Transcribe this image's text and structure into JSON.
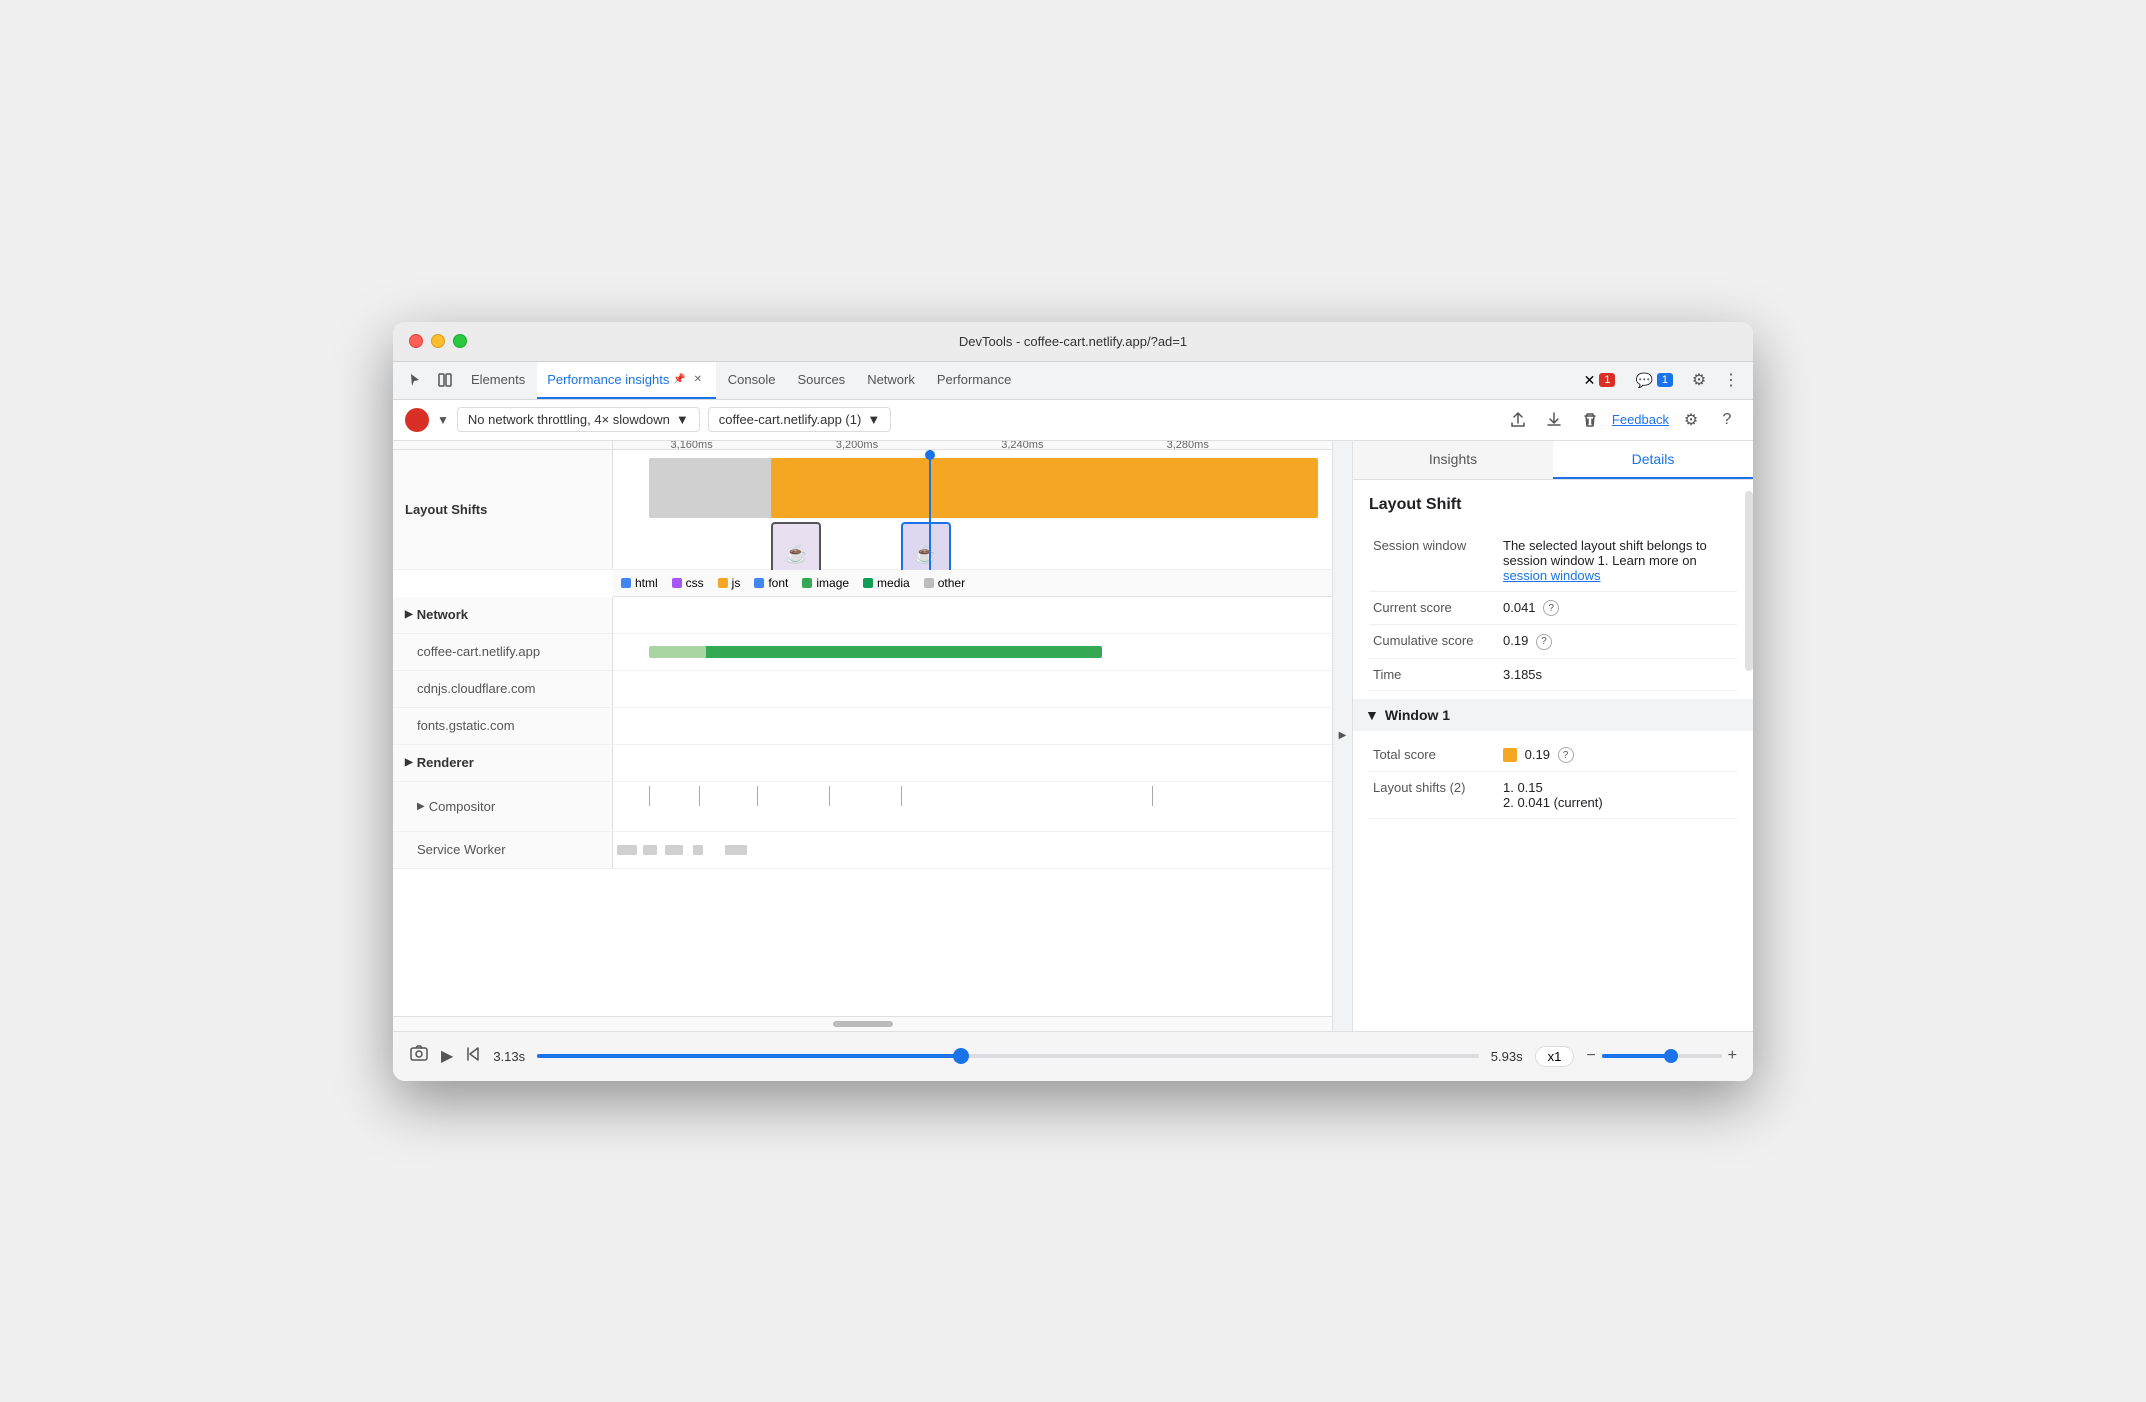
{
  "window": {
    "title": "DevTools - coffee-cart.netlify.app/?ad=1"
  },
  "tabs": {
    "items": [
      {
        "label": "Elements",
        "active": false
      },
      {
        "label": "Performance insights",
        "active": true,
        "pinned": true
      },
      {
        "label": "Console",
        "active": false
      },
      {
        "label": "Sources",
        "active": false
      },
      {
        "label": "Network",
        "active": false
      },
      {
        "label": "Performance",
        "active": false
      }
    ],
    "error_count": "1",
    "message_count": "1",
    "more_label": "»"
  },
  "toolbar": {
    "throttle_label": "No network throttling, 4× slowdown",
    "url_label": "coffee-cart.netlify.app (1)",
    "feedback_label": "Feedback"
  },
  "timeline": {
    "ruler": {
      "ticks": [
        "3,160ms",
        "3,200ms",
        "3,240ms",
        "3,280ms"
      ]
    },
    "cursor_pos": "45%",
    "sections": {
      "layout_shifts_label": "Layout Shifts",
      "network_label": "Network",
      "network_items": [
        "coffee-cart.netlify.app",
        "cdnjs.cloudflare.com",
        "fonts.gstatic.com"
      ],
      "renderer_label": "Renderer",
      "compositor_label": "Compositor",
      "service_worker_label": "Service Worker"
    },
    "legend": {
      "items": [
        {
          "color": "#4285f4",
          "label": "html"
        },
        {
          "color": "#a855f7",
          "label": "css"
        },
        {
          "color": "#f5a623",
          "label": "js"
        },
        {
          "color": "#4285f4",
          "label": "font"
        },
        {
          "color": "#34a853",
          "label": "image"
        },
        {
          "color": "#0f9d58",
          "label": "media"
        },
        {
          "color": "#bdbdbd",
          "label": "other"
        }
      ]
    }
  },
  "bottom_bar": {
    "time_start": "3.13s",
    "time_end": "5.93s",
    "speed_label": "x1",
    "slider_position": "45"
  },
  "details_panel": {
    "tabs": [
      {
        "label": "Insights",
        "active": false
      },
      {
        "label": "Details",
        "active": true
      }
    ],
    "section_title": "Layout Shift",
    "session_window_label": "Session window",
    "session_window_value": "The selected layout shift belongs to session window 1.",
    "learn_more_label": "Learn more on",
    "session_windows_link": "session windows",
    "current_score_label": "Current score",
    "current_score_value": "0.041",
    "cumulative_score_label": "Cumulative score",
    "cumulative_score_value": "0.19",
    "time_label": "Time",
    "time_value": "3.185s",
    "window1_label": "Window 1",
    "total_score_label": "Total score",
    "total_score_value": "0.19",
    "layout_shifts_label": "Layout shifts (2)",
    "layout_shifts_items": [
      "1. 0.15",
      "2. 0.041 (current)"
    ]
  }
}
